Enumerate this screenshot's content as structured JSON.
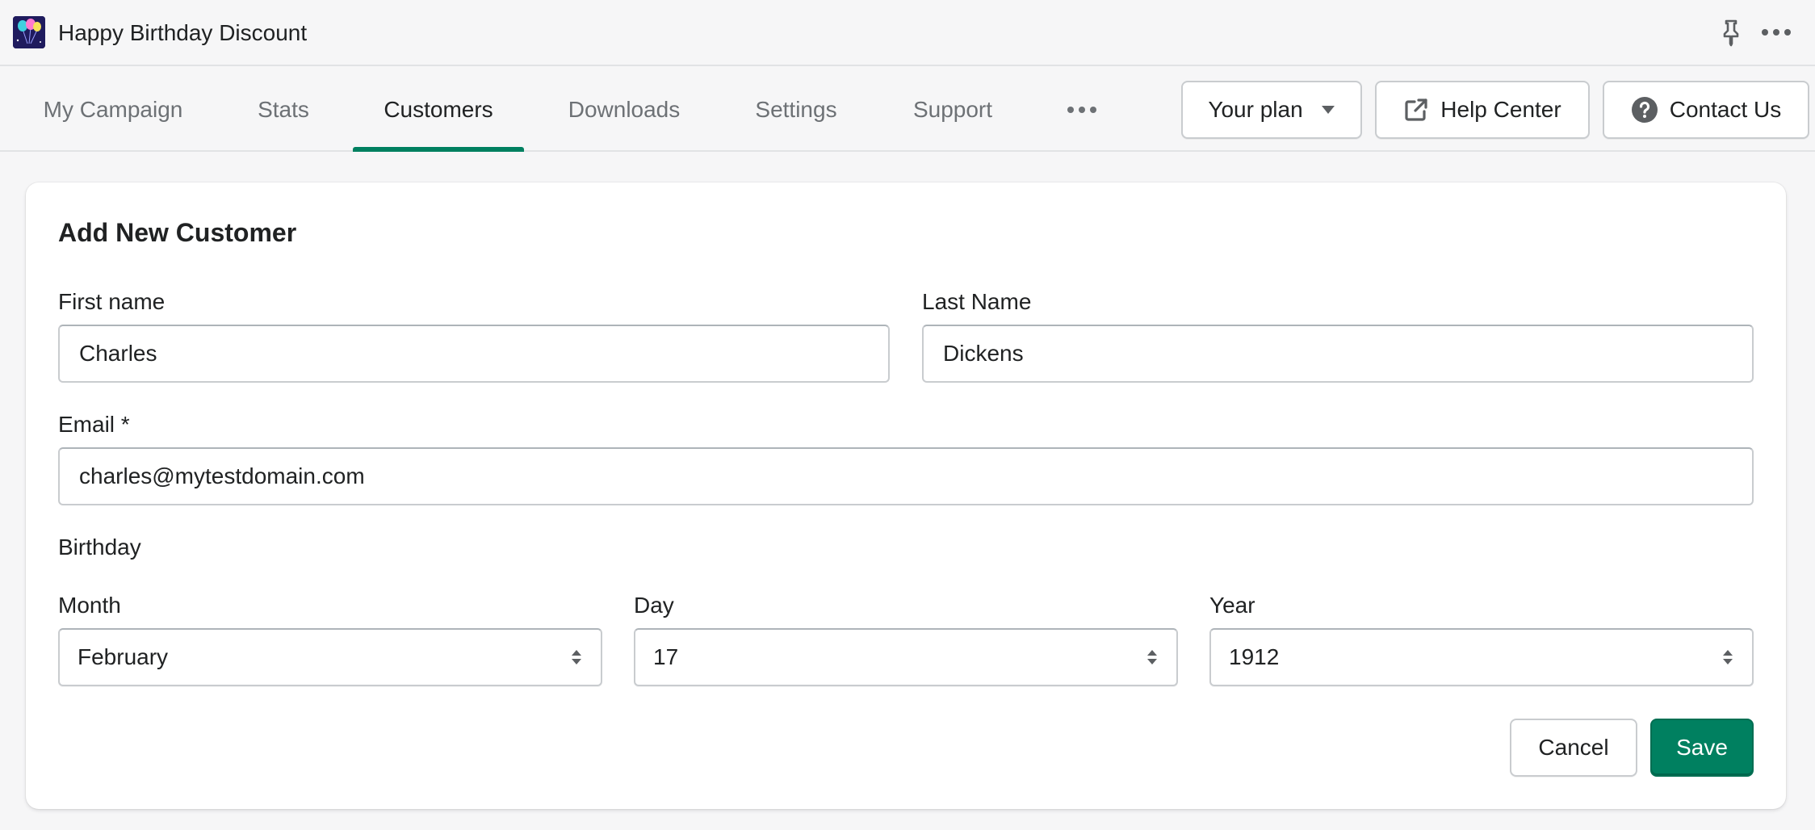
{
  "app": {
    "title": "Happy Birthday Discount",
    "logo_icon": "balloons-icon"
  },
  "titlebar": {
    "pin_icon": "pin-icon",
    "more_icon": "more-horizontal-icon"
  },
  "nav": {
    "tabs": [
      {
        "label": "My Campaign",
        "active": false
      },
      {
        "label": "Stats",
        "active": false
      },
      {
        "label": "Customers",
        "active": true
      },
      {
        "label": "Downloads",
        "active": false
      },
      {
        "label": "Settings",
        "active": false
      },
      {
        "label": "Support",
        "active": false
      }
    ],
    "more_icon": "more-horizontal-icon",
    "plan_button": "Your plan",
    "help_button": "Help Center",
    "contact_button": "Contact Us"
  },
  "form": {
    "title": "Add New Customer",
    "first_name": {
      "label": "First name",
      "value": "Charles"
    },
    "last_name": {
      "label": "Last Name",
      "value": "Dickens"
    },
    "email": {
      "label": "Email *",
      "value": "charles@mytestdomain.com"
    },
    "birthday_label": "Birthday",
    "month": {
      "label": "Month",
      "value": "February"
    },
    "day": {
      "label": "Day",
      "value": "17"
    },
    "year": {
      "label": "Year",
      "value": "1912"
    },
    "cancel_label": "Cancel",
    "save_label": "Save"
  },
  "colors": {
    "accent": "#008060",
    "background": "#f6f6f7",
    "card": "#ffffff",
    "text": "#202223",
    "muted_text": "#6d7175"
  }
}
